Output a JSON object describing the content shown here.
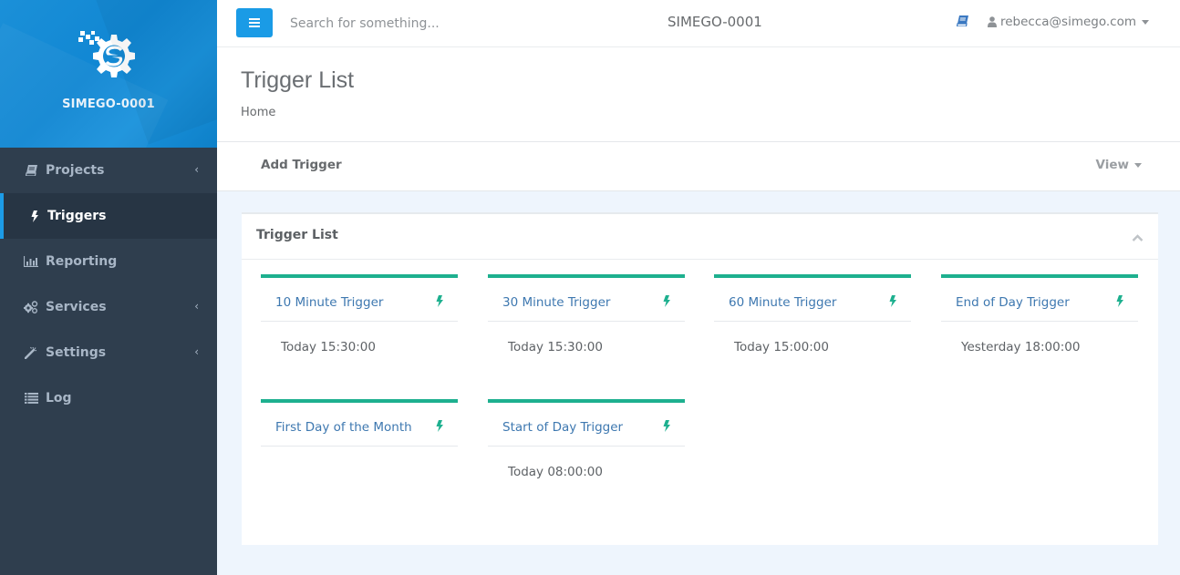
{
  "brand": {
    "name": "SIMEGO-0001",
    "logo_icon": "gear-s-logo"
  },
  "sidebar": {
    "items": [
      {
        "label": "Projects",
        "icon": "book-icon",
        "has_submenu": true,
        "active": false
      },
      {
        "label": "Triggers",
        "icon": "bolt-icon",
        "has_submenu": false,
        "active": true
      },
      {
        "label": "Reporting",
        "icon": "bar-chart-icon",
        "has_submenu": false,
        "active": false
      },
      {
        "label": "Services",
        "icon": "cogs-icon",
        "has_submenu": true,
        "active": false
      },
      {
        "label": "Settings",
        "icon": "magic-wand-icon",
        "has_submenu": true,
        "active": false
      },
      {
        "label": "Log",
        "icon": "list-icon",
        "has_submenu": false,
        "active": false
      }
    ]
  },
  "topbar": {
    "menu_icon": "hamburger-icon",
    "search_placeholder": "Search for something...",
    "title": "SIMEGO-0001",
    "docs_icon": "book-icon",
    "user": "rebecca@simego.com"
  },
  "page": {
    "title": "Trigger List",
    "breadcrumb": "Home"
  },
  "actions": {
    "add_label": "Add Trigger",
    "view_label": "View"
  },
  "panel": {
    "title": "Trigger List",
    "triggers": [
      {
        "name": "10 Minute Trigger",
        "next_run": "Today 15:30:00"
      },
      {
        "name": "30 Minute Trigger",
        "next_run": "Today 15:30:00"
      },
      {
        "name": "60 Minute Trigger",
        "next_run": "Today 15:00:00"
      },
      {
        "name": "End of Day Trigger",
        "next_run": "Yesterday 18:00:00"
      },
      {
        "name": "First Day of the Month",
        "next_run": ""
      },
      {
        "name": "Start of Day Trigger",
        "next_run": "Today 08:00:00"
      }
    ]
  },
  "colors": {
    "accent": "#1a9be6",
    "sidebar_bg": "#2f3e4e",
    "card_bar": "#1eb08f",
    "link": "#3e78b0"
  }
}
